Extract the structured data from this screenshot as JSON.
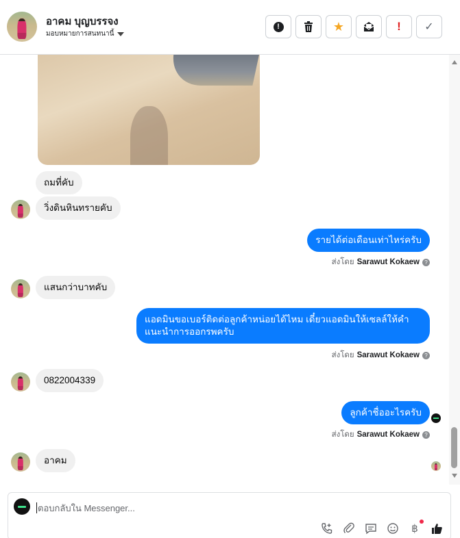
{
  "header": {
    "contact_name": "อาคม บุญบรรจง",
    "assign_label": "มอบหมายการสนทนานี้"
  },
  "toolbar": {
    "spam_icon": "exclamation-circle-icon",
    "delete_icon": "trash-icon",
    "star_icon": "star-icon",
    "archive_icon": "envelope-open-icon",
    "important_icon": "red-exclamation-icon",
    "done_icon": "check-icon"
  },
  "messages": [
    {
      "from": "contact",
      "text": "ถมที่คับ"
    },
    {
      "from": "contact",
      "text": "วิ่งดินหินทรายคับ"
    },
    {
      "from": "page",
      "text": "รายได้ต่อเดือนเท่าไหร่ครับ"
    },
    {
      "from": "contact",
      "text": "แสนกว่าบาทคับ"
    },
    {
      "from": "page",
      "text": "แอดมินขอเบอร์ติดต่อลูกค้าหน่อยได้ไหม เดี๋ยวแอดมินให้เซลล์ให้คำแนะนำการออกรพครับ"
    },
    {
      "from": "contact",
      "text": "0822004339"
    },
    {
      "from": "page",
      "text": "ลูกค้าชื่ออะไรครับ"
    },
    {
      "from": "contact",
      "text": "อาคม"
    }
  ],
  "sent_by": {
    "prefix": "ส่งโดย",
    "agent": "Sarawut Kokaew"
  },
  "composer": {
    "placeholder": "ตอบกลับใน Messenger..."
  },
  "colors": {
    "outgoing_bubble": "#0a7cff",
    "incoming_bubble": "#f0f0f0",
    "star": "#f5a623",
    "important": "#e02020"
  }
}
